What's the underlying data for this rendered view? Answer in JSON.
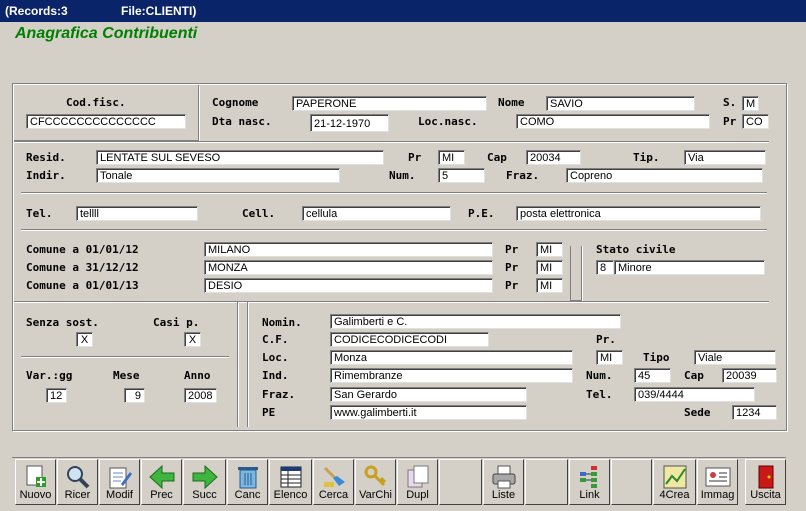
{
  "titlebar": {
    "records": "(Records:3",
    "file": "File:CLIENTI)"
  },
  "form_title": "Anagrafica Contribuenti",
  "codice_fiscale": {
    "label": "Cod.fisc.",
    "value": "CFCCCCCCCCCCCCCC"
  },
  "cognome": {
    "label": "Cognome",
    "value": "PAPERONE"
  },
  "nome": {
    "label": "Nome",
    "value": "SAVIO"
  },
  "sesso": {
    "label": "S.",
    "value": "M"
  },
  "dta_nasc": {
    "label": "Dta nasc.",
    "value": "21-12-1970"
  },
  "loc_nasc": {
    "label": "Loc.nasc.",
    "value": "COMO"
  },
  "pr_nasc": {
    "label": "Pr",
    "value": "CO"
  },
  "resid": {
    "label": "Resid.",
    "value": "LENTATE SUL SEVESO"
  },
  "pr_resid": {
    "label": "Pr",
    "value": "MI"
  },
  "cap": {
    "label": "Cap",
    "value": "20034"
  },
  "tip": {
    "label": "Tip.",
    "value": "Via"
  },
  "indir": {
    "label": "Indir.",
    "value": "Tonale"
  },
  "num": {
    "label": "Num.",
    "value": "5"
  },
  "fraz": {
    "label": "Fraz.",
    "value": "Copreno"
  },
  "tel": {
    "label": "Tel.",
    "value": "tellll"
  },
  "cell": {
    "label": "Cell.",
    "value": "cellula"
  },
  "pe": {
    "label": "P.E.",
    "value": "posta elettronica"
  },
  "comuni": [
    {
      "label": "Comune a 01/01/12",
      "value": "MILANO",
      "pr_label": "Pr",
      "pr": "MI"
    },
    {
      "label": "Comune a 31/12/12",
      "value": "MONZA",
      "pr_label": "Pr",
      "pr": "MI"
    },
    {
      "label": "Comune a 01/01/13",
      "value": "DESIO",
      "pr_label": "Pr",
      "pr": "MI"
    }
  ],
  "stato_civile": {
    "label": "Stato civile",
    "code": "8",
    "value": "Minore"
  },
  "senza_sost": {
    "label": "Senza sost.",
    "value": "X"
  },
  "casi_p": {
    "label": "Casi p.",
    "value": "X"
  },
  "var_gg": {
    "label": "Var.:gg",
    "value": "12"
  },
  "mese": {
    "label": "Mese",
    "value": "9"
  },
  "anno": {
    "label": "Anno",
    "value": "2008"
  },
  "sost": {
    "nomin": {
      "label": "Nomin.",
      "value": "Galimberti e C."
    },
    "cf": {
      "label": "C.F.",
      "value": "CODICECODICECODI"
    },
    "pr_label": "Pr.",
    "loc": {
      "label": "Loc.",
      "value": "Monza"
    },
    "loc_pr": "MI",
    "tipo": {
      "label": "Tipo",
      "value": "Viale"
    },
    "ind": {
      "label": "Ind.",
      "value": "Rimembranze"
    },
    "num": {
      "label": "Num.",
      "value": "45"
    },
    "cap": {
      "label": "Cap",
      "value": "20039"
    },
    "fraz": {
      "label": "Fraz.",
      "value": "San Gerardo"
    },
    "tel": {
      "label": "Tel.",
      "value": "039/4444"
    },
    "pe": {
      "label": "PE",
      "value": "www.galimberti.it"
    },
    "sede": {
      "label": "Sede",
      "value": "1234"
    }
  },
  "toolbar": [
    {
      "name": "nuovo",
      "label": "Nuovo",
      "icon": "new-document-icon"
    },
    {
      "name": "ricer",
      "label": "Ricer",
      "icon": "magnifier-icon"
    },
    {
      "name": "modif",
      "label": "Modif",
      "icon": "edit-icon"
    },
    {
      "name": "prec",
      "label": "Prec",
      "icon": "arrow-left-icon"
    },
    {
      "name": "succ",
      "label": "Succ",
      "icon": "arrow-right-icon"
    },
    {
      "name": "canc",
      "label": "Canc",
      "icon": "trash-icon"
    },
    {
      "name": "elenco",
      "label": "Elenco",
      "icon": "table-icon"
    },
    {
      "name": "cerca",
      "label": "Cerca",
      "icon": "search-brush-icon"
    },
    {
      "name": "varchi",
      "label": "VarChi",
      "icon": "keys-icon"
    },
    {
      "name": "dupl",
      "label": "Dupl",
      "icon": "duplicate-icon"
    },
    {
      "name": "vuoto1",
      "label": "",
      "icon": ""
    },
    {
      "name": "liste",
      "label": "Liste",
      "icon": "printer-icon"
    },
    {
      "name": "vuoto2",
      "label": "",
      "icon": ""
    },
    {
      "name": "link",
      "label": "Link",
      "icon": "link-icon"
    },
    {
      "name": "vuoto3",
      "label": "",
      "icon": ""
    },
    {
      "name": "4crea",
      "label": "4Crea",
      "icon": "chart-icon"
    },
    {
      "name": "immag",
      "label": "Immag",
      "icon": "image-card-icon"
    },
    {
      "name": "vuoto4",
      "label": "",
      "icon": ""
    },
    {
      "name": "uscita",
      "label": "Uscita",
      "icon": "exit-door-icon"
    }
  ],
  "colors": {
    "titlebar": "#0a246a",
    "form_title": "#008000",
    "window_bg": "#d4d0c8"
  }
}
